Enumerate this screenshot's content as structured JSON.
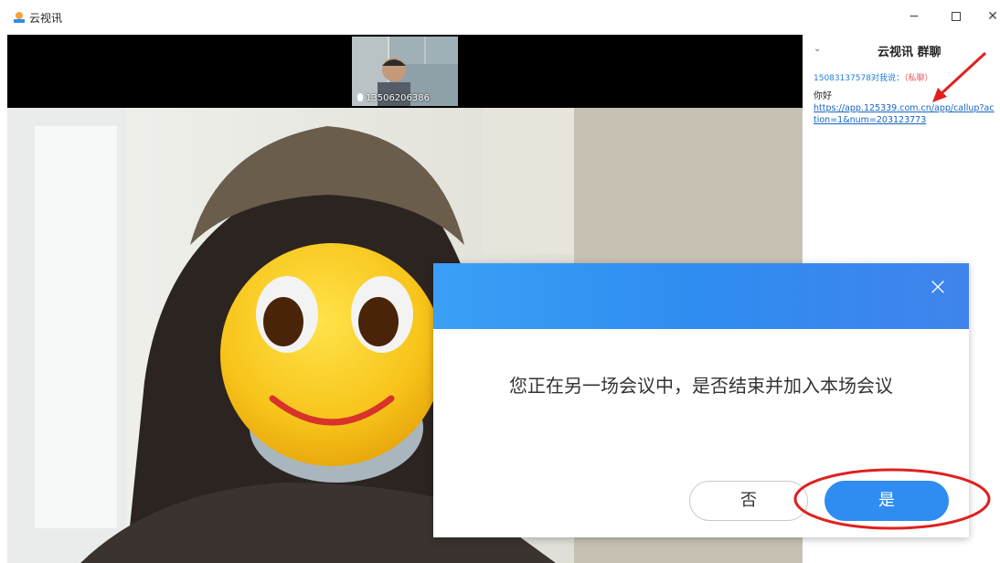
{
  "app": {
    "title": "云视讯",
    "logo_icon": "yunshixun-logo-icon"
  },
  "window_controls": {
    "minimize": "−",
    "maximize_icon": "maximize-icon",
    "close": "✕"
  },
  "participants": [
    {
      "name": "13506206386"
    }
  ],
  "chat": {
    "title": "云视讯 群聊",
    "sender_prefix": "15083137578对我说：",
    "private_tag": "（私聊）",
    "message": "你好",
    "link": "https://app.125339.com.cn/app/callup?action=1&num=203123773"
  },
  "dialog": {
    "message": "您正在另一场会议中，是否结束并加入本场会议",
    "no_label": "否",
    "yes_label": "是",
    "close_glyph": "×"
  },
  "colors": {
    "accent": "#2f8cf0",
    "annotation": "#e02020"
  }
}
